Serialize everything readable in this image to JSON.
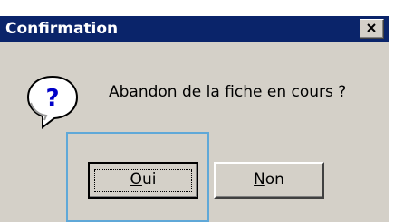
{
  "dialog": {
    "title": "Confirmation",
    "message": "Abandon de la fiche en cours ?",
    "icon": "question-icon",
    "buttons": {
      "oui_mnemonic": "O",
      "oui_rest": "ui",
      "non_mnemonic": "N",
      "non_rest": "on"
    },
    "close_icon": "close-icon"
  },
  "colors": {
    "titlebar": "#0a246a",
    "dialog_bg": "#d4d0c8",
    "highlight": "#5fa8d8"
  }
}
